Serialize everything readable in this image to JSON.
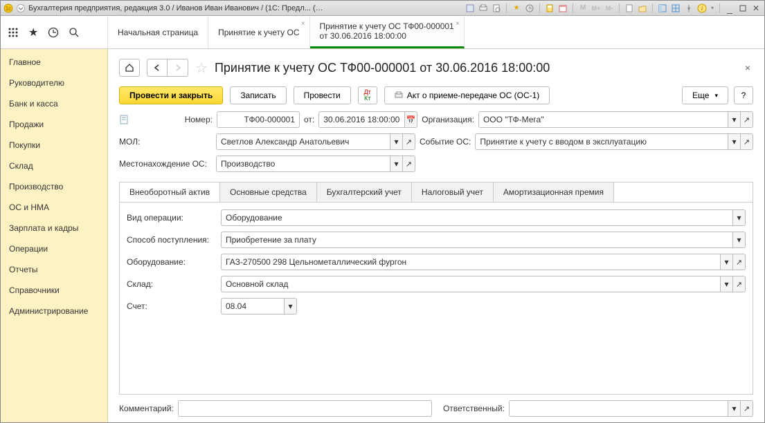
{
  "window": {
    "title": "Бухгалтерия предприятия, редакция 3.0 / Иванов Иван Иванович / (1С: Предл...   (1С:Предприятие)"
  },
  "tabs": [
    {
      "line1": "Начальная страница",
      "line2": "",
      "active": false
    },
    {
      "line1": "Принятие к учету ОС",
      "line2": "",
      "active": false
    },
    {
      "line1": "Принятие к учету ОС ТФ00-000001",
      "line2": "от 30.06.2016 18:00:00",
      "active": true
    }
  ],
  "sidebar": {
    "items": [
      "Главное",
      "Руководителю",
      "Банк и касса",
      "Продажи",
      "Покупки",
      "Склад",
      "Производство",
      "ОС и НМА",
      "Зарплата и кадры",
      "Операции",
      "Отчеты",
      "Справочники",
      "Администрирование"
    ]
  },
  "page": {
    "title": "Принятие к учету ОС ТФ00-000001 от 30.06.2016 18:00:00"
  },
  "toolbar": {
    "post_close": "Провести и закрыть",
    "save": "Записать",
    "post": "Провести",
    "report": "Акт о приеме-передаче ОС (ОС-1)",
    "more": "Еще",
    "help": "?"
  },
  "fields": {
    "number_label": "Номер:",
    "number": "ТФ00-000001",
    "date_label": "от:",
    "date": "30.06.2016 18:00:00",
    "org_label": "Организация:",
    "org": "ООО \"ТФ-Мега\"",
    "mol_label": "МОЛ:",
    "mol": "Светлов Александр Анатольевич",
    "event_label": "Событие ОС:",
    "event": "Принятие к учету с вводом в эксплуатацию",
    "loc_label": "Местонахождение ОС:",
    "loc": "Производство"
  },
  "inner_tabs": [
    "Внеоборотный актив",
    "Основные средства",
    "Бухгалтерский учет",
    "Налоговый учет",
    "Амортизационная премия"
  ],
  "inner": {
    "optype_label": "Вид операции:",
    "optype": "Оборудование",
    "acq_label": "Способ поступления:",
    "acq": "Приобретение за плату",
    "equip_label": "Оборудование:",
    "equip": "ГАЗ-270500 298 Цельнометаллический фургон",
    "store_label": "Склад:",
    "store": "Основной склад",
    "acct_label": "Счет:",
    "acct": "08.04"
  },
  "bottom": {
    "comment_label": "Комментарий:",
    "comment": "",
    "resp_label": "Ответственный:",
    "resp": ""
  }
}
